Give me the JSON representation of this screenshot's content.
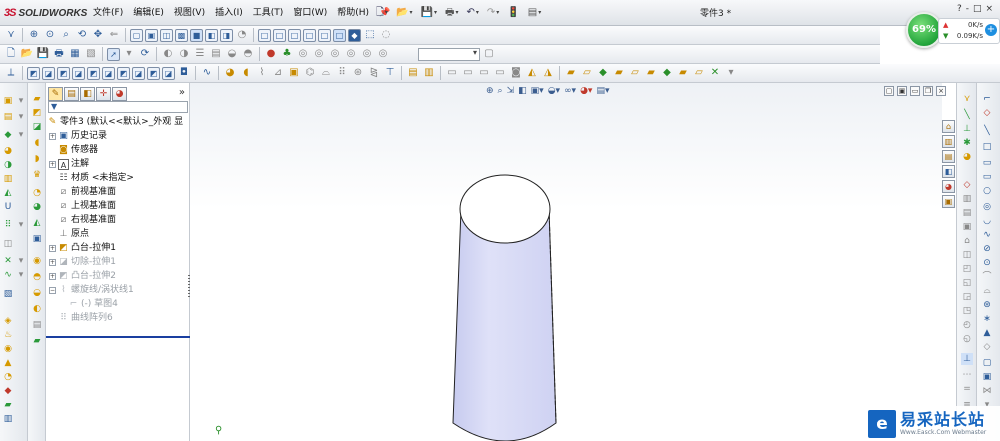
{
  "app": {
    "logo_text": "SOLIDWORKS",
    "logo_prefix": "3S",
    "document_title": "零件3 *"
  },
  "menu": {
    "items": [
      "文件(F)",
      "编辑(E)",
      "视图(V)",
      "插入(I)",
      "工具(T)",
      "窗口(W)",
      "帮助(H)"
    ]
  },
  "help_cluster": [
    "?",
    "-",
    "□",
    "×"
  ],
  "speed_widget": {
    "percent": "69%",
    "up_rate": "0K/s",
    "down_rate": "0.09K/s",
    "plus": "+"
  },
  "feature_tree": {
    "filter_text": "▼",
    "items": [
      {
        "label": "零件3 (默认<<默认>_外观 显",
        "icon": "part-icon",
        "state": "normal"
      },
      {
        "label": "历史记录",
        "icon": "history-icon",
        "state": "normal"
      },
      {
        "label": "传感器",
        "icon": "sensor-icon",
        "state": "normal"
      },
      {
        "label": "注解",
        "icon": "annotation-icon",
        "state": "normal"
      },
      {
        "label": "材质 <未指定>",
        "icon": "material-icon",
        "state": "normal"
      },
      {
        "label": "前视基准面",
        "icon": "plane-icon",
        "state": "normal"
      },
      {
        "label": "上视基准面",
        "icon": "plane-icon",
        "state": "normal"
      },
      {
        "label": "右视基准面",
        "icon": "plane-icon",
        "state": "normal"
      },
      {
        "label": "原点",
        "icon": "origin-icon",
        "state": "normal"
      },
      {
        "label": "凸台-拉伸1",
        "icon": "boss-extrude-icon",
        "state": "normal"
      },
      {
        "label": "切除-拉伸1",
        "icon": "cut-extrude-icon",
        "state": "suppressed"
      },
      {
        "label": "凸台-拉伸2",
        "icon": "boss-extrude-icon",
        "state": "suppressed"
      },
      {
        "label": "螺旋线/涡状线1",
        "icon": "helix-icon",
        "state": "suppressed"
      },
      {
        "label": "(-) 草图4",
        "icon": "sketch-icon",
        "state": "suppressed"
      },
      {
        "label": "曲线阵列6",
        "icon": "curve-pattern-icon",
        "state": "suppressed"
      }
    ]
  },
  "watermark": {
    "cn": "易采站长站",
    "en": "Www.Easck.Com Webmaster"
  },
  "colors": {
    "accent": "#1a3fa0",
    "cylinder_fill": "#d8dbf5",
    "watermark_blue": "#1565c0",
    "speed_green": "#21a43a"
  }
}
